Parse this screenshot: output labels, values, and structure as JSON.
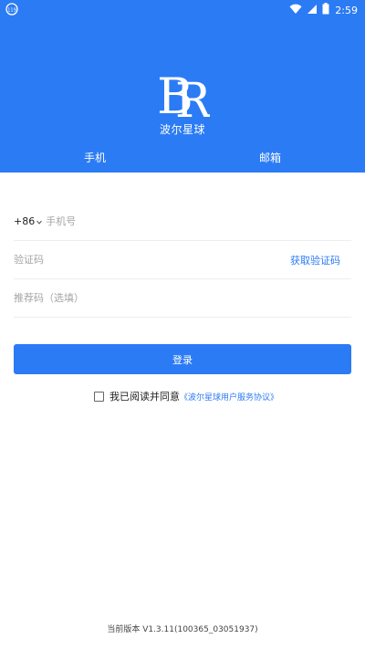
{
  "status_bar": {
    "time": "2:59",
    "left_icon": "app-notification-icon",
    "icons": [
      "wifi-icon",
      "cellular-signal-icon",
      "battery-icon"
    ]
  },
  "brand": {
    "logo_text": "BR",
    "name": "波尔星球"
  },
  "tabs": [
    {
      "label": "手机"
    },
    {
      "label": "邮箱"
    }
  ],
  "form": {
    "country_code": "+86",
    "phone_placeholder": "手机号",
    "code_placeholder": "验证码",
    "get_code_label": "获取验证码",
    "referral_placeholder": "推荐码（选填）"
  },
  "login_label": "登录",
  "agreement": {
    "checked": false,
    "text": "我已阅读并同意",
    "link": "《波尔星球用户服务协议》"
  },
  "version_text": "当前版本 V1.3.11(100365_03051937)",
  "colors": {
    "primary": "#2b7bf5",
    "text": "#222222",
    "placeholder": "#a5a5a5",
    "divider": "#eeeeee"
  }
}
